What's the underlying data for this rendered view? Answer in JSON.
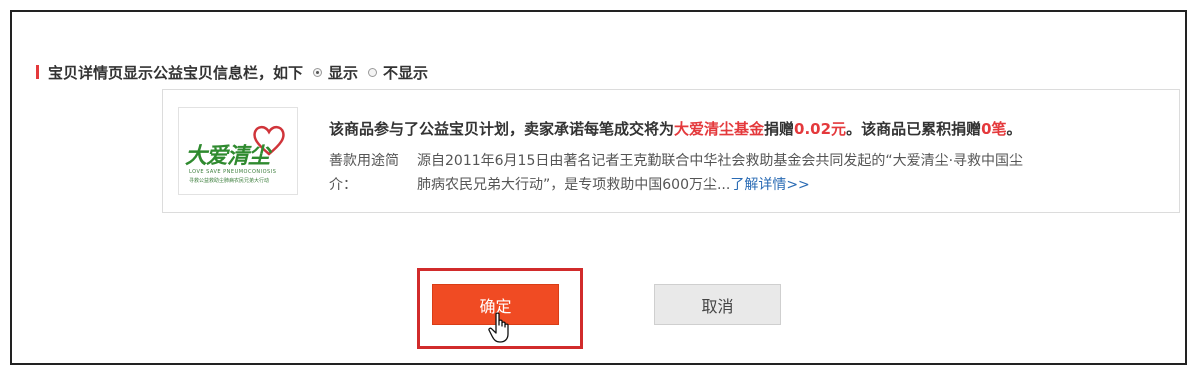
{
  "setting": {
    "title": "宝贝详情页显示公益宝贝信息栏，如下",
    "options": [
      {
        "label": "显示",
        "checked": true
      },
      {
        "label": "不显示",
        "checked": false
      }
    ]
  },
  "charity": {
    "logo_text": "大爱清尘",
    "logo_sub_en": "LOVE SAVE PNEUMOCONIOSIS",
    "logo_sub_cn": "寻救公益救助尘肺病农民兄弟大行动",
    "headline_pre": "该商品参与了公益宝贝计划，卖家承诺每笔成交将为",
    "fund_name": "大爱清尘基金",
    "headline_mid": "捐赠",
    "amount": "0.02元",
    "headline_post": "。该商品已累积捐赠",
    "count": "0笔",
    "headline_end": "。",
    "desc_label": "善款用途简介：",
    "desc_line1": "源自2011年6月15日由著名记者王克勤联合中华社会救助基金会共同发起的“大爱清尘·寻救中国尘",
    "desc_line2": "肺病农民兄弟大行动”，是专项救助中国600万尘...",
    "more_link": "了解详情>>"
  },
  "actions": {
    "confirm": "确定",
    "cancel": "取消"
  },
  "colors": {
    "accent_red": "#e4393c",
    "confirm_bg": "#f04b23",
    "link_blue": "#2a6bb4",
    "logo_green": "#2f8a2f"
  }
}
